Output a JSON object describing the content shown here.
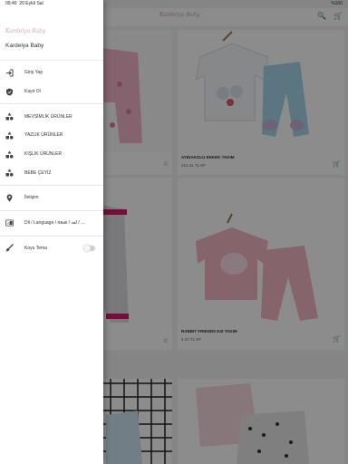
{
  "status": {
    "time": "09:40",
    "date": "20 Eylül Sal",
    "battery": "%100"
  },
  "app": {
    "logo": "Kardelya Baby"
  },
  "drawer": {
    "logo": "Kardelya Baby",
    "title": "Kardelya Baby",
    "items": [
      {
        "label": "Giriş Yap",
        "icon": "login-icon"
      },
      {
        "label": "Kayıt Ol",
        "icon": "shield-check-icon"
      },
      {
        "label": "MEVSİMLİK ÜRÜNLER",
        "icon": "category-icon"
      },
      {
        "label": "YAZLIK ÜRÜNLER",
        "icon": "category-icon"
      },
      {
        "label": "KIŞLIK ÜRÜNLER",
        "icon": "category-icon"
      },
      {
        "label": "BEBE ÇEYİZ",
        "icon": "category-icon"
      },
      {
        "label": "İletişim",
        "icon": "location-pin-icon"
      },
      {
        "label": "Dil / Language / язык / لغة / ...",
        "icon": "translate-icon"
      },
      {
        "label": "Koyu Tema",
        "icon": "brush-icon",
        "toggle": false
      }
    ]
  },
  "products": [
    {
      "name": "AYIDAKOLU ERKEK TAKIM",
      "price": "214.41 TL KF"
    },
    {
      "name": "RABBIT FRIENDS KIZ TAKIM",
      "price": "4.47.TL KF"
    }
  ],
  "colors": {
    "accent": "#b00000",
    "overlay": "rgba(0,0,0,0.45)"
  }
}
